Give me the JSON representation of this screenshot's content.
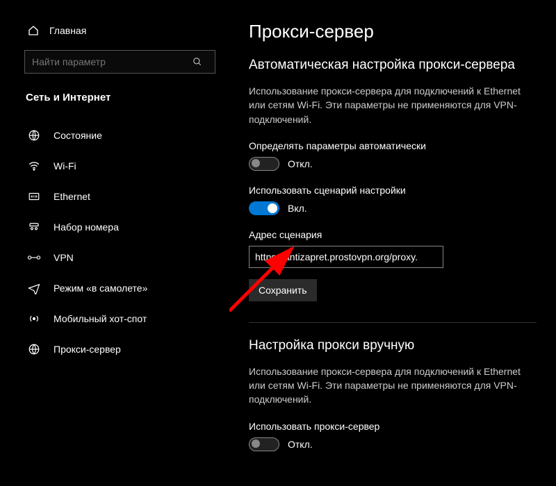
{
  "sidebar": {
    "home_label": "Главная",
    "search_placeholder": "Найти параметр",
    "category": "Сеть и Интернет",
    "items": [
      {
        "label": "Состояние"
      },
      {
        "label": "Wi-Fi"
      },
      {
        "label": "Ethernet"
      },
      {
        "label": "Набор номера"
      },
      {
        "label": "VPN"
      },
      {
        "label": "Режим «в самолете»"
      },
      {
        "label": "Мобильный хот-спот"
      },
      {
        "label": "Прокси-сервер"
      }
    ]
  },
  "main": {
    "title": "Прокси-сервер",
    "auto": {
      "heading": "Автоматическая настройка прокси-сервера",
      "desc": "Использование прокси-сервера для подключений к Ethernet или сетям Wi-Fi. Эти параметры не применяются для VPN-подключений.",
      "detect_label": "Определять параметры автоматически",
      "detect_state": "Откл.",
      "script_toggle_label": "Использовать сценарий настройки",
      "script_toggle_state": "Вкл.",
      "script_addr_label": "Адрес сценария",
      "script_addr_value": "https://antizapret.prostovpn.org/proxy.",
      "save_label": "Сохранить"
    },
    "manual": {
      "heading": "Настройка прокси вручную",
      "desc": "Использование прокси-сервера для подключений к Ethernet или сетям Wi-Fi. Эти параметры не применяются для VPN-подключений.",
      "use_label": "Использовать прокси-сервер",
      "use_state": "Откл."
    }
  }
}
